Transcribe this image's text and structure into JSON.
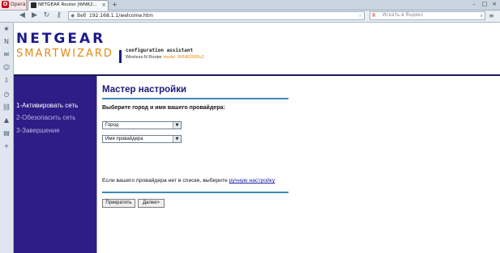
{
  "browser": {
    "opera_label": "Opera",
    "tab_title": "NETGEAR Router JWNR2...",
    "url_site": "Веб",
    "url": "192.168.1.1/welcome.htm",
    "search_placeholder": "Искать в Яндекс",
    "search_engine_icon": "yandex-icon"
  },
  "header": {
    "logo_netgear": "NETGEAR",
    "logo_smartwizard": "SMARTWIZARD",
    "assistant_title": "configuration assistant",
    "router_type": "Wireless-N Router",
    "router_model": "model JWNR2000v2"
  },
  "steps": [
    {
      "label": "1-Активировать сеть",
      "active": true
    },
    {
      "label": "2-Обезопасить сеть",
      "active": false
    },
    {
      "label": "3-Завершение",
      "active": false
    }
  ],
  "wizard": {
    "title": "Мастер настройки",
    "subtitle": "Выберите город и имя вашего провайдера:",
    "city_select": "Город",
    "provider_select": "Имя провайдера",
    "hint_text": "Если вашего провайдера нет в списке, выберите",
    "hint_link": "ручную настройку",
    "cancel_button": "Прекратить",
    "next_button": "Далее>"
  },
  "colors": {
    "nav_bg": "#2e1d86",
    "title": "#1c1a78",
    "logo_blue": "#1c1a8a",
    "logo_orange": "#e08a16",
    "rule": "#3d8bb8"
  }
}
